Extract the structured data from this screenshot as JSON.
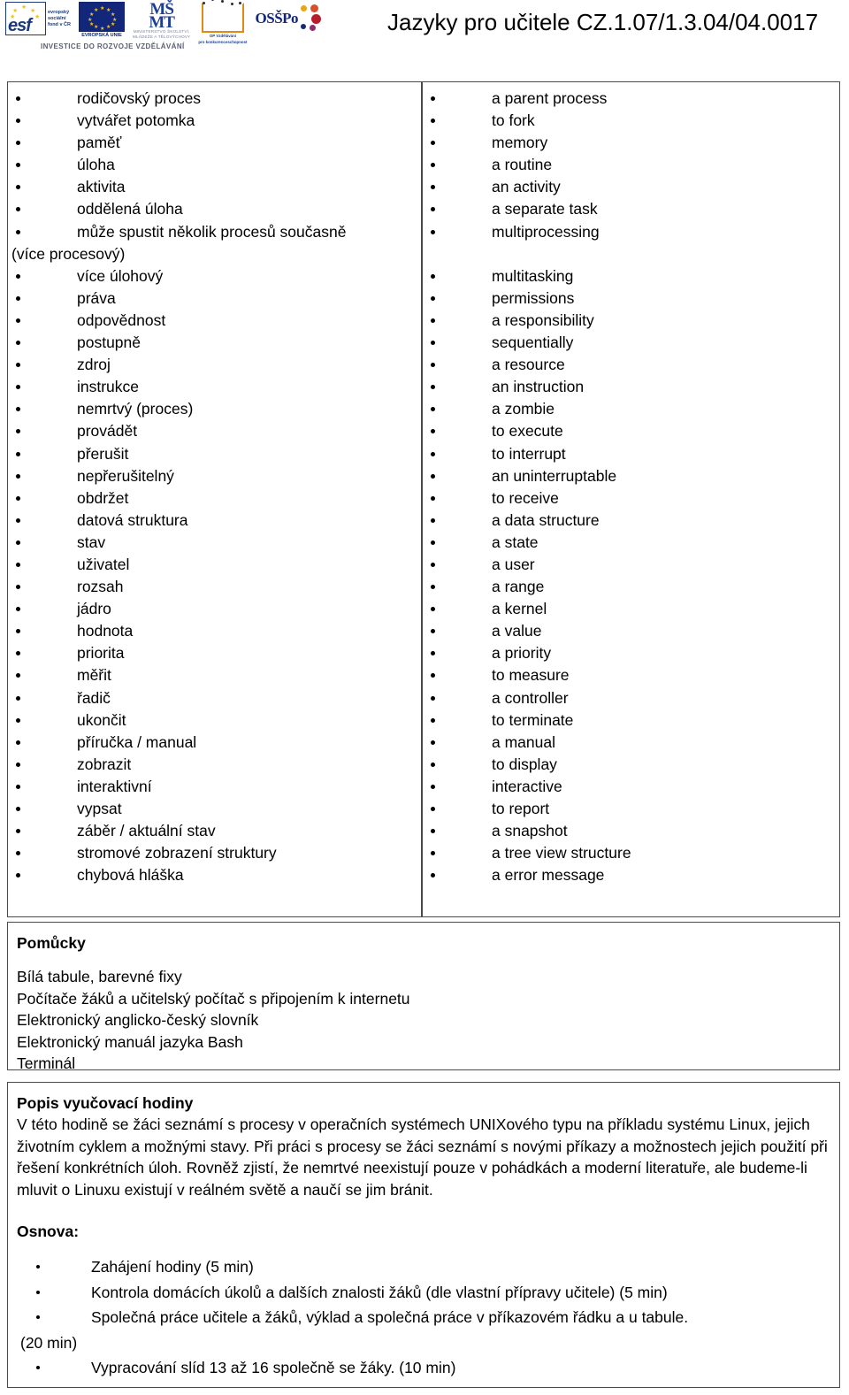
{
  "header": {
    "title": "Jazyky pro učitele CZ.1.07/1.3.04/04.0017",
    "investice_line": "INVESTICE DO ROZVOJE VZDĚLÁVÁNÍ",
    "logos": {
      "esf": {
        "letters": "esf",
        "lines": [
          "evropský",
          "sociální",
          "fond v ČR"
        ]
      },
      "eu": {
        "caption": "EVROPSKÁ UNIE"
      },
      "msmt": {
        "mark_top": "MŠ",
        "mark_bottom": "MT",
        "caption_line1": "MINISTERSTVO ŠKOLSTVÍ,",
        "caption_line2": "MLÁDEŽE A TĚLOVÝCHOVY"
      },
      "opvk": {
        "caption_line1": "OP Vzdělávání",
        "caption_line2": "pro konkurenceschopnost"
      },
      "osspo": {
        "word": "OSŠPo"
      }
    }
  },
  "vocabulary": {
    "czech": [
      {
        "text": "rodičovský proces",
        "bullet": true
      },
      {
        "text": "vytvářet potomka",
        "bullet": true
      },
      {
        "text": "paměť",
        "bullet": true
      },
      {
        "text": "úloha",
        "bullet": true
      },
      {
        "text": "aktivita",
        "bullet": true
      },
      {
        "text": "oddělená úloha",
        "bullet": true
      },
      {
        "text": "může spustit několik procesů současně",
        "bullet": true
      },
      {
        "text": "(více procesový)",
        "bullet": false,
        "wrap": true
      },
      {
        "text": "více úlohový",
        "bullet": true
      },
      {
        "text": "práva",
        "bullet": true
      },
      {
        "text": "odpovědnost",
        "bullet": true
      },
      {
        "text": "postupně",
        "bullet": true
      },
      {
        "text": "zdroj",
        "bullet": true
      },
      {
        "text": "instrukce",
        "bullet": true
      },
      {
        "text": "nemrtvý (proces)",
        "bullet": true
      },
      {
        "text": "provádět",
        "bullet": true
      },
      {
        "text": "přerušit",
        "bullet": true
      },
      {
        "text": "nepřerušitelný",
        "bullet": true
      },
      {
        "text": "obdržet",
        "bullet": true
      },
      {
        "text": "datová struktura",
        "bullet": true
      },
      {
        "text": "stav",
        "bullet": true
      },
      {
        "text": "uživatel",
        "bullet": true
      },
      {
        "text": "rozsah",
        "bullet": true
      },
      {
        "text": "jádro",
        "bullet": true
      },
      {
        "text": "hodnota",
        "bullet": true
      },
      {
        "text": "priorita",
        "bullet": true
      },
      {
        "text": "měřit",
        "bullet": true
      },
      {
        "text": "řadič",
        "bullet": true
      },
      {
        "text": "ukončit",
        "bullet": true
      },
      {
        "text": "příručka / manual",
        "bullet": true
      },
      {
        "text": "zobrazit",
        "bullet": true
      },
      {
        "text": "interaktivní",
        "bullet": true
      },
      {
        "text": "vypsat",
        "bullet": true
      },
      {
        "text": "záběr / aktuální stav",
        "bullet": true
      },
      {
        "text": "stromové zobrazení struktury",
        "bullet": true
      },
      {
        "text": "chybová hláška",
        "bullet": true
      }
    ],
    "english": [
      {
        "text": "a parent process",
        "bullet": true
      },
      {
        "text": "to fork",
        "bullet": true
      },
      {
        "text": "memory",
        "bullet": true
      },
      {
        "text": "a routine",
        "bullet": true
      },
      {
        "text": "an activity",
        "bullet": true
      },
      {
        "text": "a separate task",
        "bullet": true
      },
      {
        "text": "multiprocessing",
        "bullet": true
      },
      {
        "text": "",
        "bullet": false,
        "blank": true
      },
      {
        "text": "multitasking",
        "bullet": true
      },
      {
        "text": "permissions",
        "bullet": true
      },
      {
        "text": "a responsibility",
        "bullet": true
      },
      {
        "text": "sequentially",
        "bullet": true
      },
      {
        "text": "a resource",
        "bullet": true
      },
      {
        "text": "an instruction",
        "bullet": true
      },
      {
        "text": "a zombie",
        "bullet": true
      },
      {
        "text": "to execute",
        "bullet": true
      },
      {
        "text": "to interrupt",
        "bullet": true
      },
      {
        "text": "an uninterruptable",
        "bullet": true
      },
      {
        "text": "to receive",
        "bullet": true
      },
      {
        "text": "a data structure",
        "bullet": true
      },
      {
        "text": "a state",
        "bullet": true
      },
      {
        "text": "a user",
        "bullet": true
      },
      {
        "text": "a range",
        "bullet": true
      },
      {
        "text": "a kernel",
        "bullet": true
      },
      {
        "text": "a value",
        "bullet": true
      },
      {
        "text": "a priority",
        "bullet": true
      },
      {
        "text": "to measure",
        "bullet": true
      },
      {
        "text": "a controller",
        "bullet": true
      },
      {
        "text": "to terminate",
        "bullet": true
      },
      {
        "text": "a manual",
        "bullet": true
      },
      {
        "text": "to display",
        "bullet": true
      },
      {
        "text": "interactive",
        "bullet": true
      },
      {
        "text": "to report",
        "bullet": true
      },
      {
        "text": "a snapshot",
        "bullet": true
      },
      {
        "text": "a tree view structure",
        "bullet": true
      },
      {
        "text": "a error message",
        "bullet": true
      }
    ]
  },
  "materials": {
    "heading": "Pomůcky",
    "items": [
      "Bílá tabule, barevné fixy",
      "Počítače žáků a učitelský počítač s připojením k internetu",
      "Elektronický anglicko-český slovník",
      "Elektronický manuál jazyka Bash",
      "Terminál"
    ]
  },
  "description": {
    "heading": "Popis vyučovací hodiny",
    "body": "V této hodině se žáci seznámí s procesy v operačních systémech UNIXového typu na příkladu systému Linux, jejich životním cyklem a možnými stavy. Při práci s procesy se žáci seznámí s novými příkazy a možnostech jejich použití při řešení konkrétních úloh. Rovněž zjistí, že nemrtvé neexistují pouze v pohádkách a moderní literatuře, ale budeme-li mluvit o Linuxu existují v reálném světě a naučí se jim bránit.",
    "outline_heading": "Osnova:",
    "outline": [
      {
        "text": "Zahájení hodiny (5 min)",
        "bullet": true
      },
      {
        "text": "Kontrola domácích úkolů a dalších znalosti žáků (dle vlastní přípravy učitele) (5 min)",
        "bullet": true
      },
      {
        "text": "Společná práce učitele a žáků, výklad a společná práce v příkazovém řádku a u tabule.",
        "bullet": true
      },
      {
        "text": "(20 min)",
        "bullet": false,
        "wrap": true
      },
      {
        "text": "Vypracování slíd 13 až 16 společně se žáky.  (10 min)",
        "bullet": true
      }
    ]
  }
}
